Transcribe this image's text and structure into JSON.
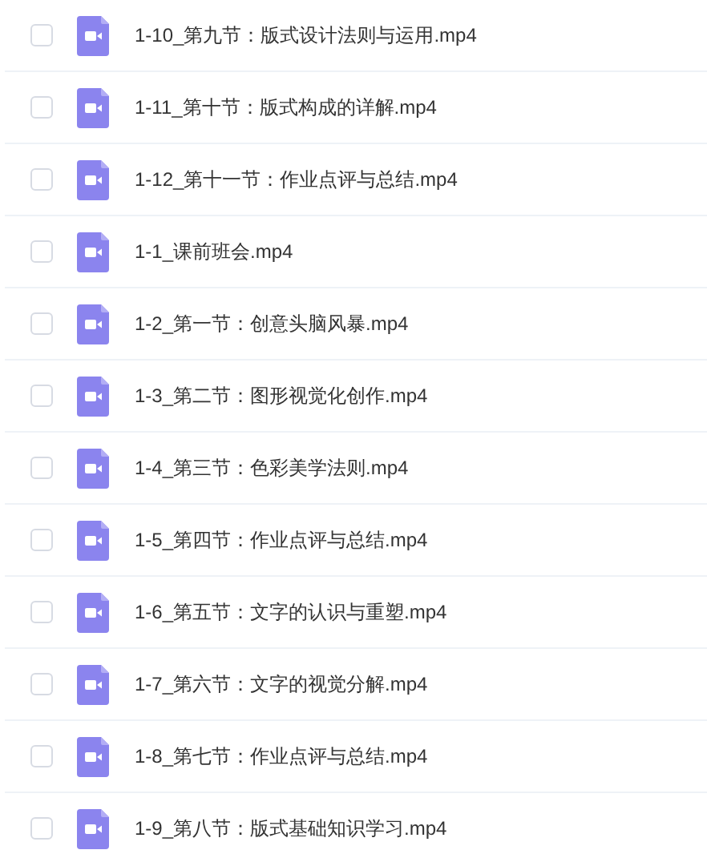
{
  "files": [
    {
      "name": "1-10_第九节：版式设计法则与运用.mp4",
      "checked": false
    },
    {
      "name": "1-11_第十节：版式构成的详解.mp4",
      "checked": false
    },
    {
      "name": "1-12_第十一节：作业点评与总结.mp4",
      "checked": false
    },
    {
      "name": "1-1_课前班会.mp4",
      "checked": false
    },
    {
      "name": "1-2_第一节：创意头脑风暴.mp4",
      "checked": false
    },
    {
      "name": "1-3_第二节：图形视觉化创作.mp4",
      "checked": false
    },
    {
      "name": "1-4_第三节：色彩美学法则.mp4",
      "checked": false
    },
    {
      "name": "1-5_第四节：作业点评与总结.mp4",
      "checked": false
    },
    {
      "name": "1-6_第五节：文字的认识与重塑.mp4",
      "checked": false
    },
    {
      "name": "1-7_第六节：文字的视觉分解.mp4",
      "checked": false
    },
    {
      "name": "1-8_第七节：作业点评与总结.mp4",
      "checked": false
    },
    {
      "name": "1-9_第八节：版式基础知识学习.mp4",
      "checked": false
    }
  ]
}
